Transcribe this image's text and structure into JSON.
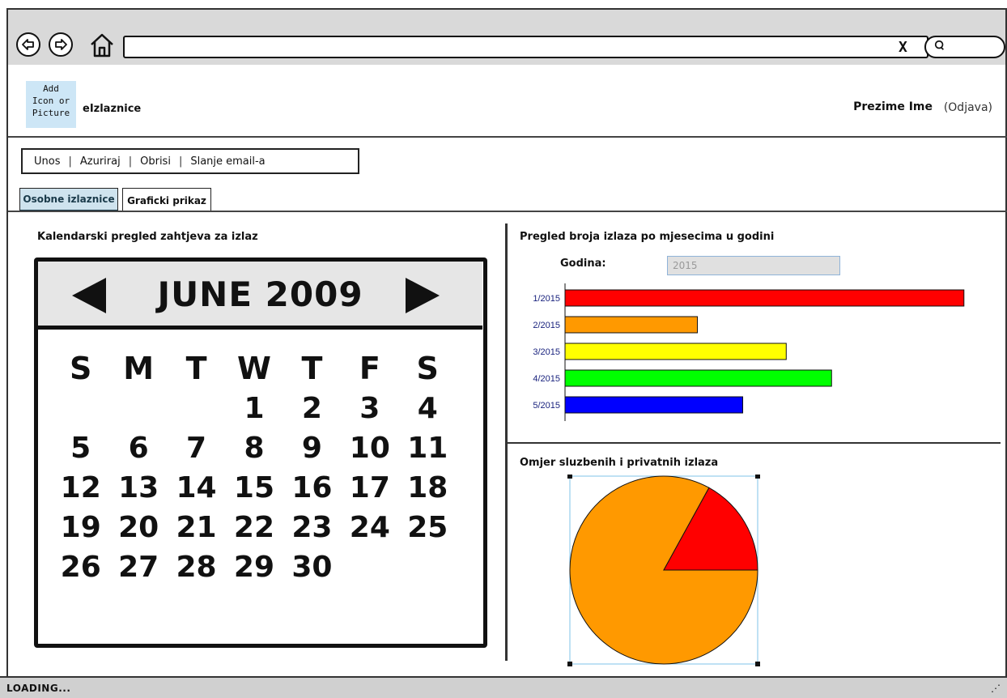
{
  "browser": {
    "back_icon": "back-arrow-icon",
    "forward_icon": "forward-arrow-icon",
    "home_icon": "home-icon",
    "url": "",
    "clear_label": "X",
    "search_icon": "search-icon"
  },
  "header": {
    "logo_text": "Add\nIcon or\nPicture",
    "app_title": "eIzlaznice",
    "user_name": "Prezime Ime",
    "logout_label": "(Odjava)"
  },
  "menu": {
    "items": [
      "Unos",
      "Azuriraj",
      "Obrisi",
      "Slanje email-a"
    ],
    "separator": "|"
  },
  "tabs": [
    {
      "label": "Osobne izlaznice",
      "active": true
    },
    {
      "label": "Graficki prikaz",
      "active": false
    }
  ],
  "calendar_panel": {
    "title": "Kalendarski pregled zahtjeva za izlaz",
    "month_label": "JUNE 2009",
    "weekdays": [
      "S",
      "M",
      "T",
      "W",
      "T",
      "F",
      "S"
    ],
    "weeks": [
      [
        "",
        "",
        "",
        "1",
        "2",
        "3",
        "4"
      ],
      [
        "5",
        "6",
        "7",
        "8",
        "9",
        "10",
        "11"
      ],
      [
        "12",
        "13",
        "14",
        "15",
        "16",
        "17",
        "18"
      ],
      [
        "19",
        "20",
        "21",
        "22",
        "23",
        "24",
        "25"
      ],
      [
        "26",
        "27",
        "28",
        "29",
        "30",
        "",
        ""
      ]
    ]
  },
  "bar_panel": {
    "title": "Pregled broja izlaza po mjesecima u godini",
    "year_label": "Godina:",
    "year_value": "2015"
  },
  "pie_panel": {
    "title": "Omjer sluzbenih i privatnih izlaza"
  },
  "status": {
    "text": "LOADING...",
    "grip_icon": "resize-grip-icon"
  },
  "chart_data": [
    {
      "type": "bar",
      "orientation": "horizontal",
      "categories": [
        "1/2015",
        "2/2015",
        "3/2015",
        "4/2015",
        "5/2015"
      ],
      "values": [
        22,
        7.3,
        12.2,
        14.7,
        9.8
      ],
      "colors": [
        "#ff0000",
        "#ff9900",
        "#ffff00",
        "#00ff00",
        "#0000ff"
      ],
      "xlim": [
        0,
        22.5
      ],
      "title": "",
      "xlabel": "",
      "ylabel": ""
    },
    {
      "type": "pie",
      "values": [
        83,
        17
      ],
      "colors": [
        "#ff9900",
        "#ff0000"
      ],
      "title": ""
    }
  ]
}
